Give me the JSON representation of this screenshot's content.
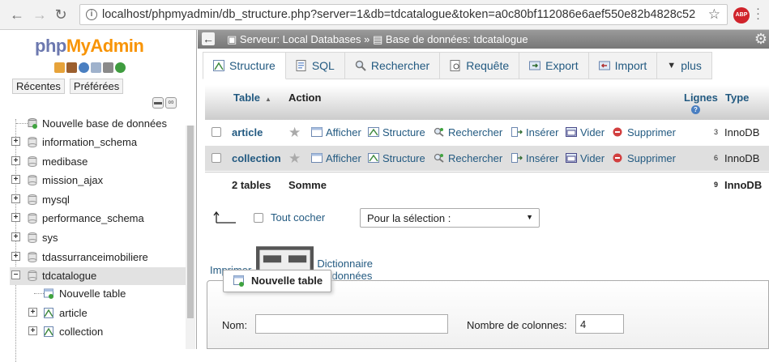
{
  "browser": {
    "url": "localhost/phpmyadmin/db_structure.php?server=1&db=tdcatalogue&token=a0c80bf112086e6aef550e82b4828c52",
    "extension_badge": "ABP"
  },
  "left": {
    "logo_php": "php",
    "logo_my": "My",
    "logo_admin": "Admin",
    "tab_recent": "Récentes",
    "tab_favorites": "Préférées",
    "tree": [
      {
        "label": "Nouvelle base de données",
        "type": "new"
      },
      {
        "label": "information_schema",
        "type": "db"
      },
      {
        "label": "medibase",
        "type": "db"
      },
      {
        "label": "mission_ajax",
        "type": "db"
      },
      {
        "label": "mysql",
        "type": "db"
      },
      {
        "label": "performance_schema",
        "type": "db"
      },
      {
        "label": "sys",
        "type": "db"
      },
      {
        "label": "tdassurranceimobiliere",
        "type": "db"
      },
      {
        "label": "tdcatalogue",
        "type": "db-open"
      },
      {
        "label": "Nouvelle table",
        "type": "new-table"
      },
      {
        "label": "article",
        "type": "table"
      },
      {
        "label": "collection",
        "type": "table"
      }
    ]
  },
  "topbar": {
    "server": "Serveur: Local Databases",
    "sep": "»",
    "database": "Base de données: tdcatalogue"
  },
  "tabs": [
    {
      "label": "Structure",
      "active": true
    },
    {
      "label": "SQL"
    },
    {
      "label": "Rechercher"
    },
    {
      "label": "Requête"
    },
    {
      "label": "Export"
    },
    {
      "label": "Import"
    },
    {
      "label": "plus"
    }
  ],
  "table": {
    "headers": {
      "table": "Table",
      "action": "Action",
      "rows": "Lignes",
      "type": "Type"
    },
    "actions": {
      "browse": "Afficher",
      "structure": "Structure",
      "search": "Rechercher",
      "insert": "Insérer",
      "empty": "Vider",
      "drop": "Supprimer"
    },
    "rows": [
      {
        "name": "article",
        "rows": "3",
        "type": "InnoDB"
      },
      {
        "name": "collection",
        "rows": "6",
        "type": "InnoDB"
      }
    ],
    "footer": {
      "count": "2 tables",
      "sum": "Somme",
      "rows": "9",
      "type": "InnoDB"
    }
  },
  "bulk": {
    "check_all": "Tout cocher",
    "select_value": "Pour la sélection :"
  },
  "links": {
    "print": "Imprimer",
    "dictionary": "Dictionnaire de données"
  },
  "create_table": {
    "legend": "Nouvelle table",
    "name_label": "Nom:",
    "name_value": "",
    "cols_label": "Nombre de colonnes:",
    "cols_value": "4"
  }
}
